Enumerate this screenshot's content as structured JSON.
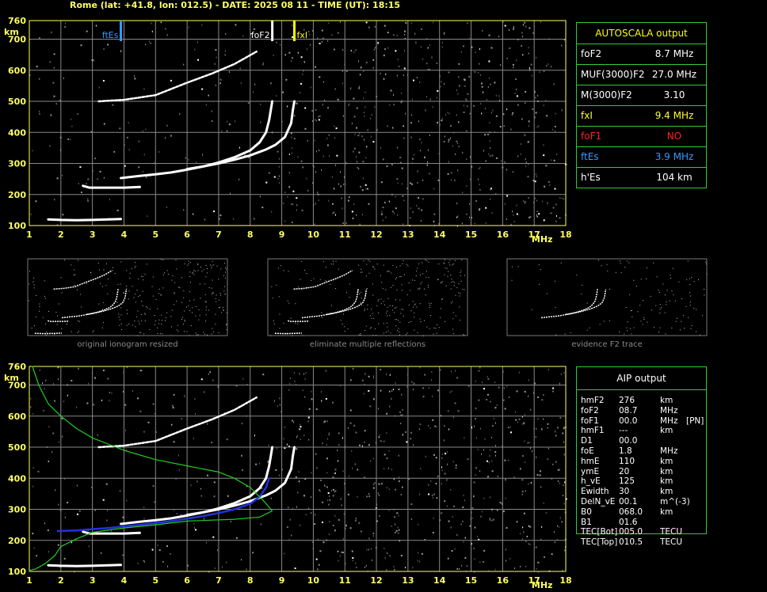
{
  "header": "Rome (lat: +41.8, lon: 012.5) - DATE: 2025 08 11 - TIME (UT): 18:15",
  "colors": {
    "axis": "#ffff66",
    "grid": "#888888",
    "table_border": "#33cc33",
    "trace": "#ffffff",
    "fxl": "#ffff00",
    "ftEs": "#3399ff",
    "profile": "#22cc22",
    "aip_trace": "#2233dd",
    "noise": "#aaaaaa"
  },
  "autoscala": {
    "title": "AUTOSCALA output",
    "rows": [
      {
        "label": "foF2",
        "value": "8.7 MHz",
        "color": "#ffffff"
      },
      {
        "label": "MUF(3000)F2",
        "value": "27.0 MHz",
        "color": "#ffffff"
      },
      {
        "label": "M(3000)F2",
        "value": "3.10",
        "color": "#ffffff"
      },
      {
        "label": "fxI",
        "value": "9.4 MHz",
        "color": "#ffff33"
      },
      {
        "label": "foF1",
        "value": "NO",
        "color": "#ff2222"
      },
      {
        "label": "ftEs",
        "value": "3.9 MHz",
        "color": "#3399ff"
      },
      {
        "label": "h'Es",
        "value": "104     km",
        "color": "#ffffff"
      }
    ]
  },
  "aip": {
    "title": "AIP output",
    "rows": [
      {
        "name": "hmF2",
        "value": "276",
        "unit": "km",
        "extra": ""
      },
      {
        "name": "foF2",
        "value": "08.7",
        "unit": "MHz",
        "extra": ""
      },
      {
        "name": "foF1",
        "value": "00.0",
        "unit": "MHz",
        "extra": "[PN]"
      },
      {
        "name": "hmF1",
        "value": "---",
        "unit": "km",
        "extra": ""
      },
      {
        "name": "D1",
        "value": "00.0",
        "unit": "",
        "extra": ""
      },
      {
        "name": "foE",
        "value": "1.8",
        "unit": "MHz",
        "extra": ""
      },
      {
        "name": "hmE",
        "value": "110",
        "unit": "km",
        "extra": ""
      },
      {
        "name": "ymE",
        "value": "20",
        "unit": "km",
        "extra": ""
      },
      {
        "name": "h_vE",
        "value": "125",
        "unit": "km",
        "extra": ""
      },
      {
        "name": "Ewidth",
        "value": "30",
        "unit": "km",
        "extra": ""
      },
      {
        "name": "DelN_vE",
        "value": "00.1",
        "unit": "m^(-3)",
        "extra": ""
      },
      {
        "name": "B0",
        "value": "068.0",
        "unit": "km",
        "extra": ""
      },
      {
        "name": "B1",
        "value": "01.6",
        "unit": "",
        "extra": ""
      },
      {
        "name": "TEC[Bot]",
        "value": "005.0",
        "unit": "TECU",
        "extra": ""
      },
      {
        "name": "TEC[Top]",
        "value": "010.5",
        "unit": "TECU",
        "extra": ""
      }
    ]
  },
  "captions": [
    "original ionogram resized",
    "eliminate multiple reflections",
    "evidence F2 trace"
  ],
  "chart_data": [
    {
      "type": "scatter",
      "xlabel": "MHz",
      "ylabel": "km",
      "xlim": [
        1,
        18
      ],
      "ylim": [
        100,
        760
      ],
      "x_ticks": [
        1,
        2,
        3,
        4,
        5,
        6,
        7,
        8,
        9,
        10,
        11,
        12,
        13,
        14,
        15,
        16,
        17,
        18
      ],
      "y_ticks": [
        100,
        200,
        300,
        400,
        500,
        600,
        700,
        760
      ],
      "markers": [
        {
          "label": "ftEs",
          "x": 3.9
        },
        {
          "label": "foF2",
          "x": 8.7
        },
        {
          "label": "fxI",
          "x": 9.4
        }
      ],
      "series": [
        {
          "points": [
            [
              1.6,
              120
            ],
            [
              2,
              118
            ],
            [
              2.5,
              117
            ],
            [
              3,
              118
            ],
            [
              3.5,
              120
            ],
            [
              3.9,
              121
            ]
          ]
        },
        {
          "points": [
            [
              2.7,
              228
            ],
            [
              2.9,
              222
            ],
            [
              3.2,
              222
            ],
            [
              3.6,
              222
            ],
            [
              4,
              222
            ],
            [
              4.5,
              224
            ]
          ]
        },
        {
          "points": [
            [
              3.9,
              253
            ],
            [
              4.5,
              260
            ],
            [
              5,
              265
            ],
            [
              5.5,
              271
            ],
            [
              6,
              280
            ],
            [
              6.5,
              290
            ],
            [
              7,
              303
            ],
            [
              7.5,
              320
            ],
            [
              8,
              342
            ],
            [
              8.3,
              368
            ],
            [
              8.5,
              400
            ],
            [
              8.6,
              440
            ],
            [
              8.7,
              500
            ]
          ]
        },
        {
          "points": [
            [
              6,
              282
            ],
            [
              6.5,
              290
            ],
            [
              7,
              300
            ],
            [
              7.5,
              312
            ],
            [
              8,
              326
            ],
            [
              8.5,
              345
            ],
            [
              8.8,
              360
            ],
            [
              9.1,
              385
            ],
            [
              9.3,
              430
            ],
            [
              9.35,
              470
            ],
            [
              9.4,
              500
            ]
          ]
        },
        {
          "points": [
            [
              3.2,
              500
            ],
            [
              4,
              505
            ],
            [
              5,
              520
            ],
            [
              6,
              560
            ],
            [
              6.8,
              590
            ],
            [
              7.5,
              620
            ],
            [
              8.2,
              660
            ]
          ]
        }
      ]
    },
    {
      "type": "line",
      "xlabel": "MHz",
      "ylabel": "km",
      "xlim": [
        1,
        18
      ],
      "ylim": [
        100,
        760
      ],
      "x_ticks": [
        1,
        2,
        3,
        4,
        5,
        6,
        7,
        8,
        9,
        10,
        11,
        12,
        13,
        14,
        15,
        16,
        17,
        18
      ],
      "y_ticks": [
        100,
        200,
        300,
        400,
        500,
        600,
        700,
        760
      ],
      "series": [
        {
          "points": [
            [
              1.6,
              120
            ],
            [
              2,
              118
            ],
            [
              2.5,
              117
            ],
            [
              3,
              118
            ],
            [
              3.5,
              120
            ],
            [
              3.9,
              121
            ]
          ]
        },
        {
          "points": [
            [
              2.7,
              228
            ],
            [
              2.9,
              222
            ],
            [
              3.2,
              222
            ],
            [
              3.6,
              222
            ],
            [
              4,
              222
            ],
            [
              4.5,
              224
            ]
          ]
        },
        {
          "points": [
            [
              3.9,
              253
            ],
            [
              4.5,
              260
            ],
            [
              5,
              265
            ],
            [
              5.5,
              271
            ],
            [
              6,
              280
            ],
            [
              6.5,
              290
            ],
            [
              7,
              303
            ],
            [
              7.5,
              320
            ],
            [
              8,
              342
            ],
            [
              8.3,
              368
            ],
            [
              8.5,
              400
            ],
            [
              8.6,
              440
            ],
            [
              8.7,
              500
            ]
          ]
        },
        {
          "points": [
            [
              6,
              282
            ],
            [
              6.5,
              290
            ],
            [
              7,
              300
            ],
            [
              7.5,
              312
            ],
            [
              8,
              326
            ],
            [
              8.5,
              345
            ],
            [
              8.8,
              360
            ],
            [
              9.1,
              385
            ],
            [
              9.3,
              430
            ],
            [
              9.35,
              470
            ],
            [
              9.4,
              500
            ]
          ]
        },
        {
          "points": [
            [
              3.2,
              500
            ],
            [
              4,
              505
            ],
            [
              5,
              520
            ],
            [
              6,
              560
            ],
            [
              6.8,
              590
            ],
            [
              7.5,
              620
            ],
            [
              8.2,
              660
            ]
          ]
        },
        {
          "points": [
            [
              1.9,
              230
            ],
            [
              2.5,
              232
            ],
            [
              3,
              236
            ],
            [
              3.5,
              240
            ],
            [
              4,
              245
            ],
            [
              4.5,
              250
            ],
            [
              5,
              256
            ],
            [
              5.5,
              262
            ],
            [
              6,
              270
            ],
            [
              6.5,
              278
            ],
            [
              7,
              288
            ],
            [
              7.5,
              300
            ],
            [
              8,
              318
            ],
            [
              8.3,
              340
            ],
            [
              8.5,
              370
            ],
            [
              8.6,
              400
            ]
          ]
        },
        {
          "points": [
            [
              1.1,
              760
            ],
            [
              1.3,
              700
            ],
            [
              1.6,
              640
            ],
            [
              2,
              600
            ],
            [
              2.5,
              560
            ],
            [
              3,
              530
            ],
            [
              4,
              490
            ],
            [
              5,
              460
            ],
            [
              6,
              440
            ],
            [
              7,
              420
            ],
            [
              7.5,
              400
            ],
            [
              8,
              370
            ],
            [
              8.4,
              330
            ],
            [
              8.7,
              295
            ],
            [
              8.3,
              275
            ],
            [
              7.5,
              268
            ],
            [
              6,
              262
            ],
            [
              5,
              250
            ],
            [
              4,
              240
            ],
            [
              3,
              226
            ],
            [
              2.5,
              205
            ],
            [
              2,
              180
            ],
            [
              1.8,
              150
            ],
            [
              1.5,
              125
            ],
            [
              1.2,
              108
            ],
            [
              1,
              103
            ]
          ]
        }
      ]
    }
  ]
}
